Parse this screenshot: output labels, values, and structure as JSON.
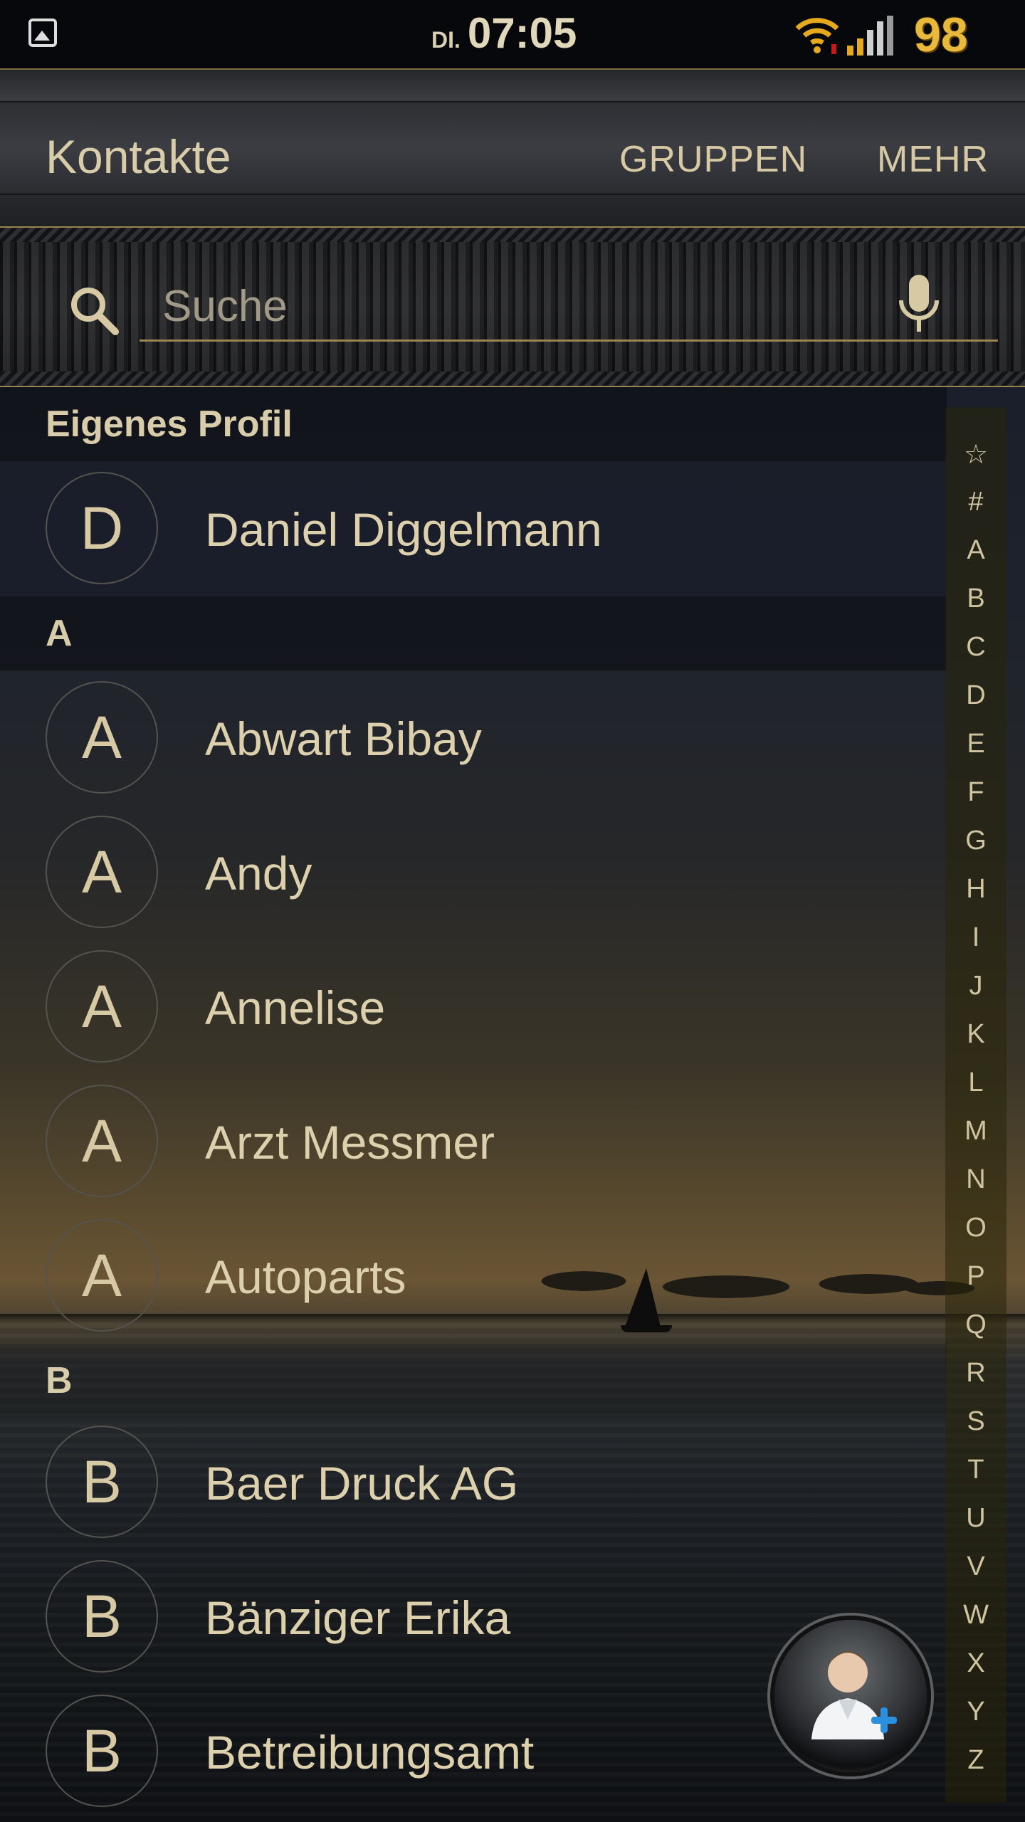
{
  "status_bar": {
    "day": "DI.",
    "time": "07:05",
    "battery": "98",
    "icons": [
      "image-notification-icon",
      "wifi-icon",
      "signal-icon"
    ]
  },
  "app_bar": {
    "title": "Kontakte",
    "tabs": [
      {
        "label": "GRUPPEN"
      },
      {
        "label": "MEHR"
      }
    ]
  },
  "search": {
    "placeholder": "Suche",
    "value": ""
  },
  "profile_section": {
    "header": "Eigenes Profil",
    "name": "Daniel Diggelmann",
    "initial": "D"
  },
  "sections": [
    {
      "letter": "A",
      "contacts": [
        {
          "initial": "A",
          "name": "Abwart Bibay"
        },
        {
          "initial": "A",
          "name": "Andy"
        },
        {
          "initial": "A",
          "name": "Annelise"
        },
        {
          "initial": "A",
          "name": "Arzt Messmer"
        },
        {
          "initial": "A",
          "name": "Autoparts"
        }
      ]
    },
    {
      "letter": "B",
      "contacts": [
        {
          "initial": "B",
          "name": "Baer Druck AG"
        },
        {
          "initial": "B",
          "name": "Bänziger Erika"
        },
        {
          "initial": "B",
          "name": "Betreibungsamt"
        }
      ]
    }
  ],
  "index_letters": [
    "☆",
    "#",
    "A",
    "B",
    "C",
    "D",
    "E",
    "F",
    "G",
    "H",
    "I",
    "J",
    "K",
    "L",
    "M",
    "N",
    "O",
    "P",
    "Q",
    "R",
    "S",
    "T",
    "U",
    "V",
    "W",
    "X",
    "Y",
    "Z"
  ],
  "colors": {
    "accent_gold": "#d6c9a4",
    "divider_gold": "#9a8552",
    "battery": "#e8b93a"
  }
}
